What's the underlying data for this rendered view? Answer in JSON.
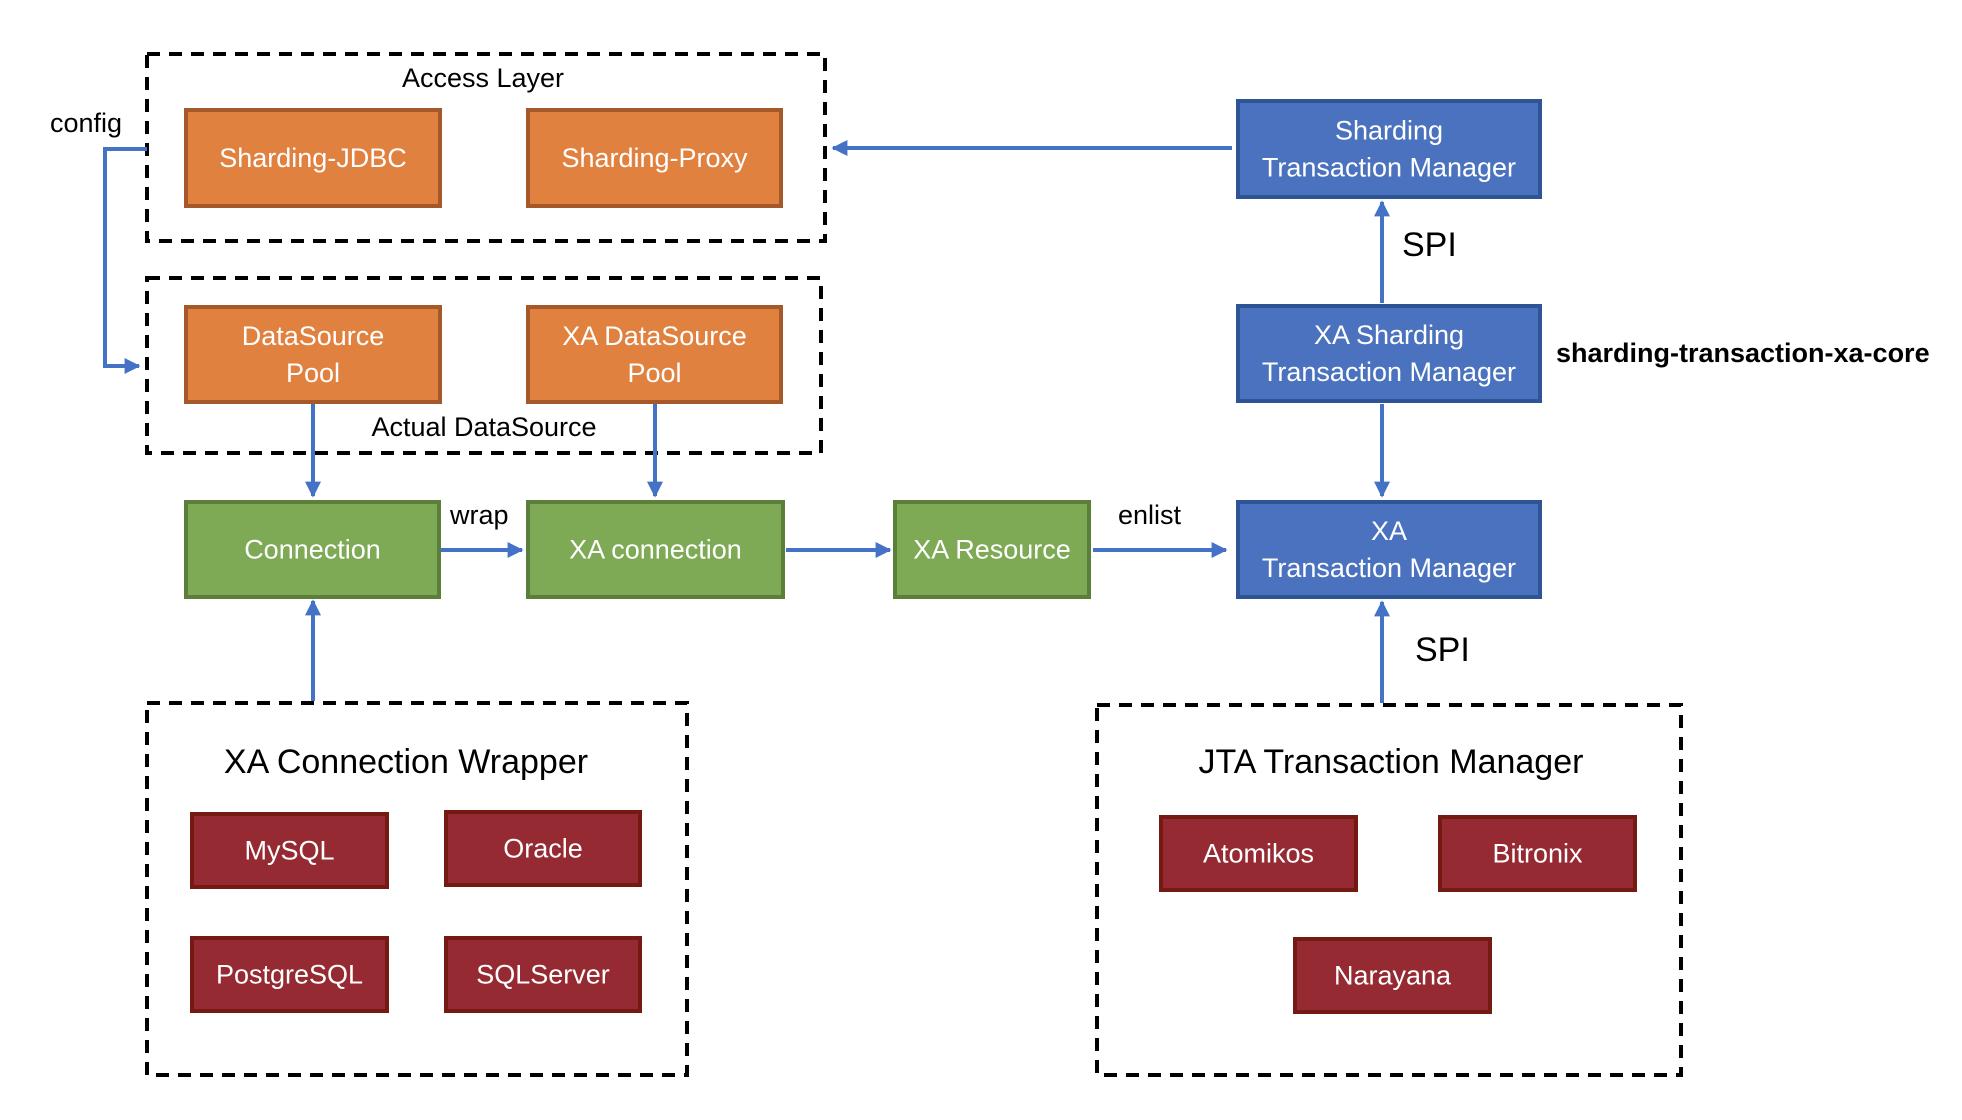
{
  "colors": {
    "orange_fill": "#E0813F",
    "orange_border": "#A5582A",
    "green_fill": "#7EAA55",
    "green_border": "#5B7F3A",
    "blue_fill": "#4A72BE",
    "blue_border": "#2F5496",
    "red_fill": "#952A33",
    "red_border": "#751A12",
    "edge": "#4472C4"
  },
  "groups": {
    "access_layer": {
      "title": "Access Layer"
    },
    "actual_datasource": {
      "title": "Actual DataSource"
    },
    "xa_connection_wrapper": {
      "title": "XA Connection Wrapper"
    },
    "jta_transaction_manager": {
      "title": "JTA Transaction Manager"
    }
  },
  "nodes": {
    "sharding_jdbc": {
      "lines": [
        "Sharding-JDBC"
      ]
    },
    "sharding_proxy": {
      "lines": [
        "Sharding-Proxy"
      ]
    },
    "datasource_pool": {
      "lines": [
        "DataSource",
        "Pool"
      ]
    },
    "xa_datasource_pool": {
      "lines": [
        "XA DataSource",
        "Pool"
      ]
    },
    "connection": {
      "lines": [
        "Connection"
      ]
    },
    "xa_connection": {
      "lines": [
        "XA connection"
      ]
    },
    "xa_resource": {
      "lines": [
        "XA Resource"
      ]
    },
    "sharding_tm": {
      "lines": [
        "Sharding",
        "Transaction Manager"
      ]
    },
    "xa_sharding_tm": {
      "lines": [
        "XA Sharding",
        "Transaction Manager"
      ]
    },
    "xa_tm": {
      "lines": [
        "XA",
        "Transaction Manager"
      ]
    },
    "mysql": {
      "lines": [
        "MySQL"
      ]
    },
    "oracle": {
      "lines": [
        "Oracle"
      ]
    },
    "postgresql": {
      "lines": [
        "PostgreSQL"
      ]
    },
    "sqlserver": {
      "lines": [
        "SQLServer"
      ]
    },
    "atomikos": {
      "lines": [
        "Atomikos"
      ]
    },
    "bitronix": {
      "lines": [
        "Bitronix"
      ]
    },
    "narayana": {
      "lines": [
        "Narayana"
      ]
    }
  },
  "labels": {
    "config": "config",
    "wrap": "wrap",
    "enlist": "enlist",
    "spi_top": "SPI",
    "spi_bottom": "SPI",
    "module": "sharding-transaction-xa-core"
  },
  "edges": [
    {
      "from": "sharding_tm",
      "to": "access_layer",
      "label": ""
    },
    {
      "from": "access_layer",
      "to": "actual_datasource",
      "label": "config"
    },
    {
      "from": "datasource_pool",
      "to": "connection",
      "label": ""
    },
    {
      "from": "xa_datasource_pool",
      "to": "xa_connection",
      "label": ""
    },
    {
      "from": "connection",
      "to": "xa_connection",
      "label": "wrap"
    },
    {
      "from": "xa_connection",
      "to": "xa_resource",
      "label": ""
    },
    {
      "from": "xa_resource",
      "to": "xa_tm",
      "label": "enlist"
    },
    {
      "from": "xa_sharding_tm",
      "to": "sharding_tm",
      "label": "SPI"
    },
    {
      "from": "xa_sharding_tm",
      "to": "xa_tm",
      "label": ""
    },
    {
      "from": "jta_transaction_manager",
      "to": "xa_tm",
      "label": "SPI"
    },
    {
      "from": "xa_connection_wrapper",
      "to": "connection",
      "label": ""
    }
  ]
}
